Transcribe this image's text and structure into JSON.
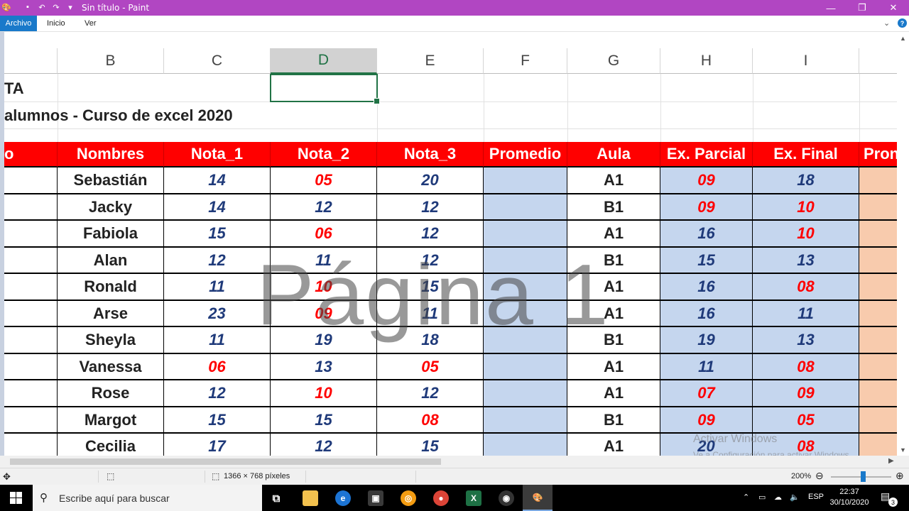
{
  "window": {
    "title": "Sin título - Paint"
  },
  "ribbon": {
    "file_tab": "Archivo",
    "tabs": [
      "Inicio",
      "Ver"
    ]
  },
  "sheet": {
    "columns": [
      "B",
      "C",
      "D",
      "E",
      "F",
      "G",
      "H",
      "I"
    ],
    "selected_column": "D",
    "title_fragment": "TA",
    "subtitle": "alumnos - Curso de excel 2020",
    "headers": [
      "o",
      "Nombres",
      "Nota_1",
      "Nota_2",
      "Nota_3",
      "Promedio",
      "Aula",
      "Ex. Parcial",
      "Ex. Final",
      "Pron"
    ],
    "rows": [
      {
        "name": "Sebastián",
        "n1": "14",
        "n2": "05",
        "n3": "20",
        "aula": "A1",
        "parcial": "09",
        "final": "18"
      },
      {
        "name": "Jacky",
        "n1": "14",
        "n2": "12",
        "n3": "12",
        "aula": "B1",
        "parcial": "09",
        "final": "10"
      },
      {
        "name": "Fabiola",
        "n1": "15",
        "n2": "06",
        "n3": "12",
        "aula": "A1",
        "parcial": "16",
        "final": "10"
      },
      {
        "name": "Alan",
        "n1": "12",
        "n2": "11",
        "n3": "12",
        "aula": "B1",
        "parcial": "15",
        "final": "13"
      },
      {
        "name": "Ronald",
        "n1": "11",
        "n2": "10",
        "n3": "15",
        "aula": "A1",
        "parcial": "16",
        "final": "08"
      },
      {
        "name": "Arse",
        "n1": "23",
        "n2": "09",
        "n3": "11",
        "aula": "A1",
        "parcial": "16",
        "final": "11"
      },
      {
        "name": "Sheyla",
        "n1": "11",
        "n2": "19",
        "n3": "18",
        "aula": "B1",
        "parcial": "19",
        "final": "13"
      },
      {
        "name": "Vanessa",
        "n1": "06",
        "n2": "13",
        "n3": "05",
        "aula": "A1",
        "parcial": "11",
        "final": "08"
      },
      {
        "name": "Rose",
        "n1": "12",
        "n2": "10",
        "n3": "12",
        "aula": "A1",
        "parcial": "07",
        "final": "09"
      },
      {
        "name": "Margot",
        "n1": "15",
        "n2": "15",
        "n3": "08",
        "aula": "B1",
        "parcial": "09",
        "final": "05"
      },
      {
        "name": "Cecilia",
        "n1": "17",
        "n2": "12",
        "n3": "15",
        "aula": "A1",
        "parcial": "20",
        "final": "08"
      }
    ],
    "watermark": "Página 1",
    "activate_title": "Activar Windows",
    "activate_sub": "Ve a Configuración para activar Windows."
  },
  "statusbar": {
    "dimensions": "1366 × 768 píxeles",
    "zoom": "200%"
  },
  "taskbar": {
    "search_placeholder": "Escribe aquí para buscar",
    "language": "ESP",
    "time": "22:37",
    "date": "30/10/2020",
    "notifications": "3"
  },
  "colors": {
    "title_bar": "#b146c2",
    "header_red": "#ff0000",
    "cell_blue": "#c5d6ee",
    "cell_peach": "#f8cbad",
    "grade_blue": "#1f3a7a",
    "grade_red": "#ff0000"
  }
}
